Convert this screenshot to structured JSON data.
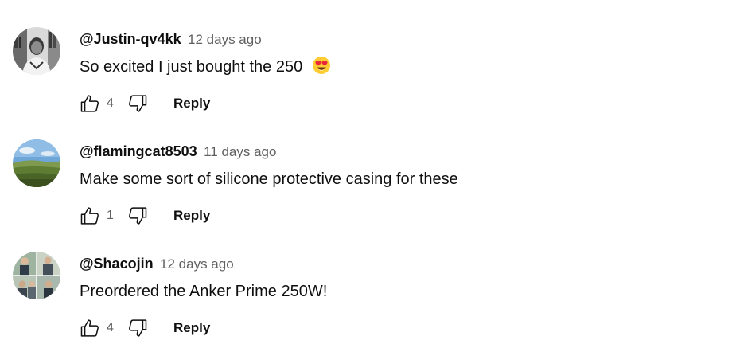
{
  "comments": [
    {
      "author": "@Justin-qv4kk",
      "time": "12 days ago",
      "text": "So excited I just bought the 250",
      "emoji_icon": "heart-eyes-emoji",
      "likes": "4",
      "reply_label": "Reply"
    },
    {
      "author": "@flamingcat8503",
      "time": "11 days ago",
      "text": "Make some sort of silicone protective casing for these",
      "likes": "1",
      "reply_label": "Reply"
    },
    {
      "author": "@Shacojin",
      "time": "12 days ago",
      "text": "Preordered the Anker Prime 250W!",
      "likes": "4",
      "reply_label": "Reply"
    }
  ],
  "colors": {
    "text_primary": "#0f0f0f",
    "text_secondary": "#606060",
    "background": "#ffffff"
  }
}
